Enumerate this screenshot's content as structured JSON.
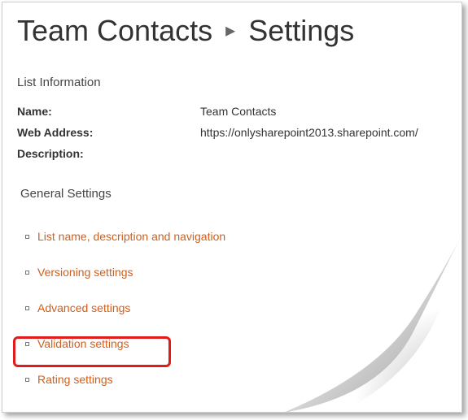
{
  "breadcrumb": {
    "list_name": "Team Contacts",
    "page": "Settings"
  },
  "list_info": {
    "heading": "List Information",
    "rows": [
      {
        "label": "Name:",
        "value": "Team Contacts"
      },
      {
        "label": "Web Address:",
        "value": "https://onlysharepoint2013.sharepoint.com/"
      },
      {
        "label": "Description:",
        "value": ""
      }
    ]
  },
  "general": {
    "heading": "General Settings",
    "links": [
      "List name, description and navigation",
      "Versioning settings",
      "Advanced settings",
      "Validation settings",
      "Rating settings"
    ]
  }
}
